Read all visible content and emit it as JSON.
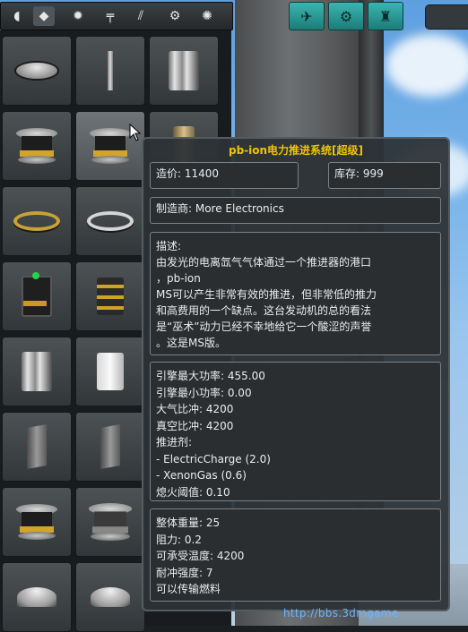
{
  "toolbar": {
    "categories": [
      {
        "icon": "pod-icon",
        "glyph": "◖",
        "active": false
      },
      {
        "icon": "fuel-tank-icon",
        "glyph": "◆",
        "active": true
      },
      {
        "icon": "engine-icon",
        "glyph": "✹",
        "active": false
      },
      {
        "icon": "structural-icon",
        "glyph": "╤",
        "active": false
      },
      {
        "icon": "aero-icon",
        "glyph": "⫽",
        "active": false
      },
      {
        "icon": "utility-icon",
        "glyph": "⚙",
        "active": false
      },
      {
        "icon": "science-icon",
        "glyph": "✺",
        "active": false
      }
    ],
    "right_tabs": [
      {
        "icon": "actions-icon",
        "glyph": "✈"
      },
      {
        "icon": "settings-gear-icon",
        "glyph": "⚙"
      },
      {
        "icon": "crew-icon",
        "glyph": "♜"
      }
    ]
  },
  "tooltip": {
    "title": "pb-ion电力推进系统[超级]",
    "cost": "造价: 11400",
    "stock": "库存: 999",
    "manufacturer": "制造商: More Electronics",
    "description": [
      "描述:",
      "由发光的电离氙气气体通过一个推进器的港口",
      "，pb-ion",
      "MS可以产生非常有效的推进，但非常低的推力",
      "和高费用的一个缺点。这台发动机的总的看法",
      "是“巫术”动力已经不幸地给它一个酸涩的声誉",
      "。这是MS版。"
    ],
    "engine_stats": [
      "引擎最大功率: 455.00",
      "引擎最小功率: 0.00",
      "大气比冲: 4200",
      "真空比冲: 4200",
      "推进剂:",
      "- ElectricCharge (2.0)",
      "- XenonGas (0.6)",
      "熄火阈值: 0.10"
    ],
    "physical_stats": [
      "整体重量: 25",
      "阻力: 0.2",
      "可承受温度: 4200",
      "耐冲强度: 7",
      "可以传输燃料"
    ]
  },
  "watermark": "http://bbs.3dmgame"
}
